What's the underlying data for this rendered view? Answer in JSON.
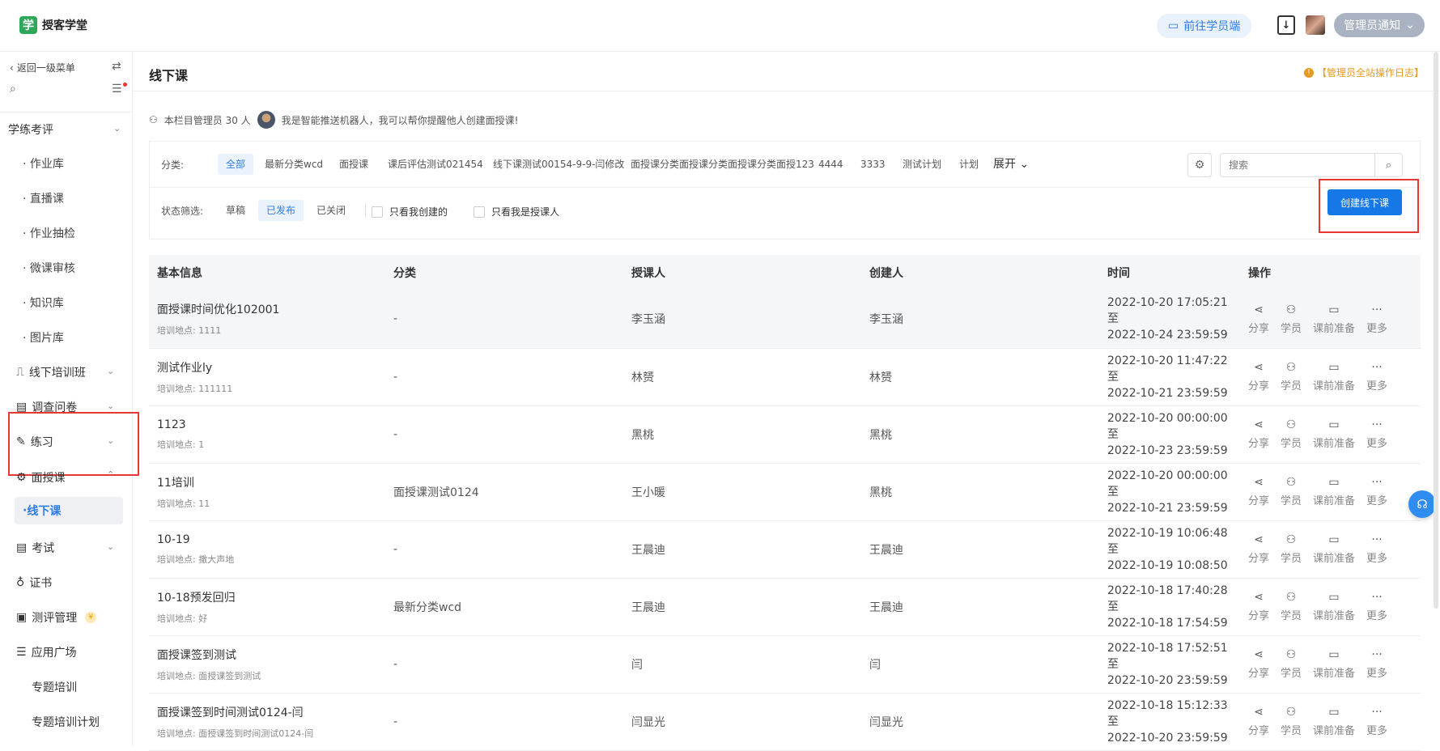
{
  "topbar": {
    "app_name": "授客学堂",
    "logo_char": "学",
    "goto_student": "前往学员端",
    "notice": "管理员通知"
  },
  "sidebar": {
    "back": "返回一级菜单",
    "group1": "学练考评",
    "group1_items": [
      "作业库",
      "直播课",
      "作业抽检",
      "微课审核",
      "知识库",
      "图片库"
    ],
    "offline_class": "线下培训班",
    "survey": "调查问卷",
    "practice": "练习",
    "face_course": "面授课",
    "active_item": "线下课",
    "exam": "考试",
    "certificate": "证书",
    "eval_mgmt": "测评管理",
    "eval_badge": "¥",
    "app_square": "应用广场",
    "app_items": [
      "专题培训",
      "专题培训计划"
    ]
  },
  "main": {
    "title": "线下课",
    "log_link": "【管理员全站操作日志】",
    "admin_info": "本栏目管理员 30 人",
    "robot_msg": "我是智能推送机器人，我可以帮你提醒他人创建面授课!",
    "filter": {
      "category_label": "分类:",
      "categories": [
        "全部",
        "最新分类wcd",
        "面授课",
        "课后评估测试021454",
        "线下课测试00154-9-9-闫修改",
        "面授课分类面授课分类面授课分类面授123",
        "4444",
        "3333",
        "测试计划",
        "计划"
      ],
      "expand": "展开",
      "search_placeholder": "搜索",
      "status_label": "状态筛选:",
      "statuses": [
        "草稿",
        "已发布",
        "已关闭"
      ],
      "only_mine": "只看我创建的",
      "only_teacher": "只看我是授课人",
      "create_btn": "创建线下课"
    },
    "table": {
      "headers": [
        "基本信息",
        "分类",
        "授课人",
        "创建人",
        "时间",
        "操作"
      ],
      "ops": [
        "分享",
        "学员",
        "课前准备",
        "更多"
      ],
      "rows": [
        {
          "name": "面授课时间优化102001",
          "loc": "培训地点: 1111",
          "category": "-",
          "teacher": "李玉涵",
          "creator": "李玉涵",
          "start": "2022-10-20 17:05:21 至",
          "end": "2022-10-24 23:59:59"
        },
        {
          "name": "测试作业ly",
          "loc": "培训地点: 111111",
          "category": "-",
          "teacher": "林赟",
          "creator": "林赟",
          "start": "2022-10-20 11:47:22 至",
          "end": "2022-10-21 23:59:59"
        },
        {
          "name": "1123",
          "loc": "培训地点: 1",
          "category": "-",
          "teacher": "黑桃",
          "creator": "黑桃",
          "start": "2022-10-20 00:00:00 至",
          "end": "2022-10-23 23:59:59"
        },
        {
          "name": "11培训",
          "loc": "培训地点: 11",
          "category": "面授课测试0124",
          "teacher": "王小暖",
          "creator": "黑桃",
          "start": "2022-10-20 00:00:00 至",
          "end": "2022-10-21 23:59:59"
        },
        {
          "name": "10-19",
          "loc": "培训地点: 撒大声地",
          "category": "-",
          "teacher": "王晨迪",
          "creator": "王晨迪",
          "start": "2022-10-19 10:06:48 至",
          "end": "2022-10-19 10:08:50"
        },
        {
          "name": "10-18预发回归",
          "loc": "培训地点: 好",
          "category": "最新分类wcd",
          "teacher": "王晨迪",
          "creator": "王晨迪",
          "start": "2022-10-18 17:40:28 至",
          "end": "2022-10-18 17:54:59"
        },
        {
          "name": "面授课签到测试",
          "loc": "培训地点: 面授课签到测试",
          "category": "-",
          "teacher": "闫",
          "creator": "闫",
          "start": "2022-10-18 17:52:51 至",
          "end": "2022-10-20 23:59:59"
        },
        {
          "name": "面授课签到时间测试0124-闫",
          "loc": "培训地点: 面授课签到时间测试0124-闫",
          "category": "-",
          "teacher": "闫显光",
          "creator": "闫显光",
          "start": "2022-10-18 15:12:33 至",
          "end": "2022-10-20 23:59:59"
        }
      ]
    }
  }
}
